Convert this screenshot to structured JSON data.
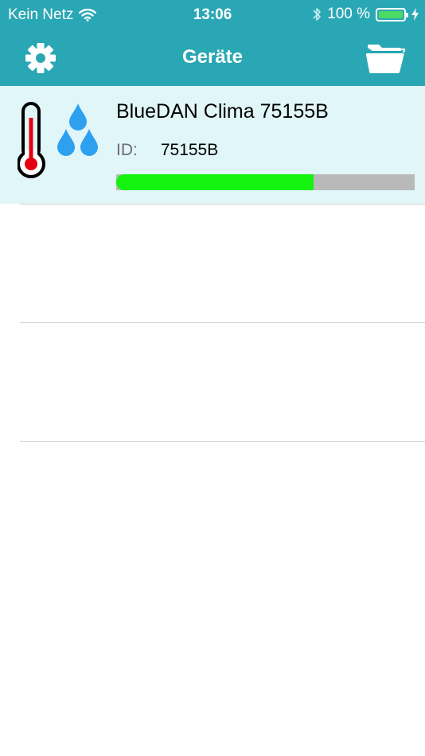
{
  "status_bar": {
    "carrier": "Kein Netz",
    "time": "13:06",
    "battery_percent": "100 %",
    "battery_level": 1.0,
    "icons": [
      "wifi-icon",
      "bluetooth-icon",
      "battery-icon",
      "charging-icon"
    ]
  },
  "navbar": {
    "title": "Geräte",
    "left_icon": "settings-gear-icon",
    "right_icon": "folder-icon"
  },
  "devices": [
    {
      "name": "BlueDAN Clima 75155B",
      "id_label": "ID:",
      "id_value": "75155B",
      "signal_level": 0.66,
      "icon": "thermometer-humidity-icon"
    }
  ],
  "colors": {
    "bar_background": "#2aa7b4",
    "row_highlight": "#e0f6f9",
    "progress_fill": "#14f20f",
    "progress_track": "#b9b9b9",
    "thermometer_red": "#e3000f",
    "drop_blue": "#2da0f0"
  }
}
